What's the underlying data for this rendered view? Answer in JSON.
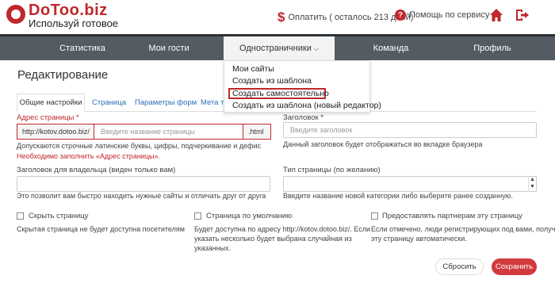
{
  "header": {
    "logo_name": "DoToo.biz",
    "logo_tagline": "Используй готовое",
    "payment_label": "Оплатить ( осталось 213 дней)",
    "help_label": "Помощь по сервису",
    "icons": [
      "dollar-icon",
      "help-icon",
      "home-icon",
      "exit-icon"
    ]
  },
  "nav": {
    "items": [
      {
        "label": "Статистика"
      },
      {
        "label": "Мои гости"
      },
      {
        "label": "Одностраничники"
      },
      {
        "label": "Команда"
      },
      {
        "label": "Профиль"
      }
    ],
    "active_index": 2
  },
  "dropdown": {
    "items": [
      {
        "label": "Мои сайты"
      },
      {
        "label": "Создать из шаблона"
      },
      {
        "label": "Создать самостоятельно"
      },
      {
        "label": "Создать из шаблона (новый редактор)"
      }
    ],
    "highlighted_index": 2
  },
  "page": {
    "title": "Редактирование",
    "tabs": [
      {
        "label": "Общие настройки"
      },
      {
        "label": "Страница"
      },
      {
        "label": "Параметры форм"
      },
      {
        "label": "Мета те"
      }
    ]
  },
  "form": {
    "address": {
      "label": "Адрес страницы *",
      "prefix": "http://kotov.dotoo.biz/",
      "placeholder": "Введите название страницы",
      "suffix": ".html",
      "hint": "Допускаются строчные латинские буквы, цифры, подчеркивание и дефис",
      "error": "Необходимо заполнить «Адрес страницы»."
    },
    "heading": {
      "label": "Заголовок *",
      "placeholder": "Введите заголовок",
      "hint": "Данный заголовок будет отображаться во вкладке браузера"
    },
    "owner_title": {
      "label": "Заголовок для владельца (виден только вам)",
      "hint": "Это позволит вам быстро находить нужные сайты и отличать друг от друга"
    },
    "page_type": {
      "label": "Тип страницы (по желанию)",
      "hint": "Введите название новой категории либо выберите ранее созданную."
    },
    "checkboxes": [
      {
        "label": "Скрыть страницу",
        "desc": [
          "Скрытая страница не будет доступна посетителям"
        ]
      },
      {
        "label": "Страница по умолчанию",
        "desc": [
          "Будет доступна по адресу http://kotov.dotoo.biz/. Если",
          "указать несколько будет выбрана случайная из",
          "указанных."
        ]
      },
      {
        "label": "Предоставлять партнерам эту страницу",
        "desc": [
          "Если отмечено, люди регистрирующих под вами, получат",
          "эту страницу автоматически."
        ]
      }
    ],
    "reset_label": "Сбросить",
    "save_label": "Сохранить"
  },
  "colors": {
    "brand_red": "#c0282c",
    "nav_bg": "#545b62",
    "link_blue": "#2a6ebb"
  }
}
